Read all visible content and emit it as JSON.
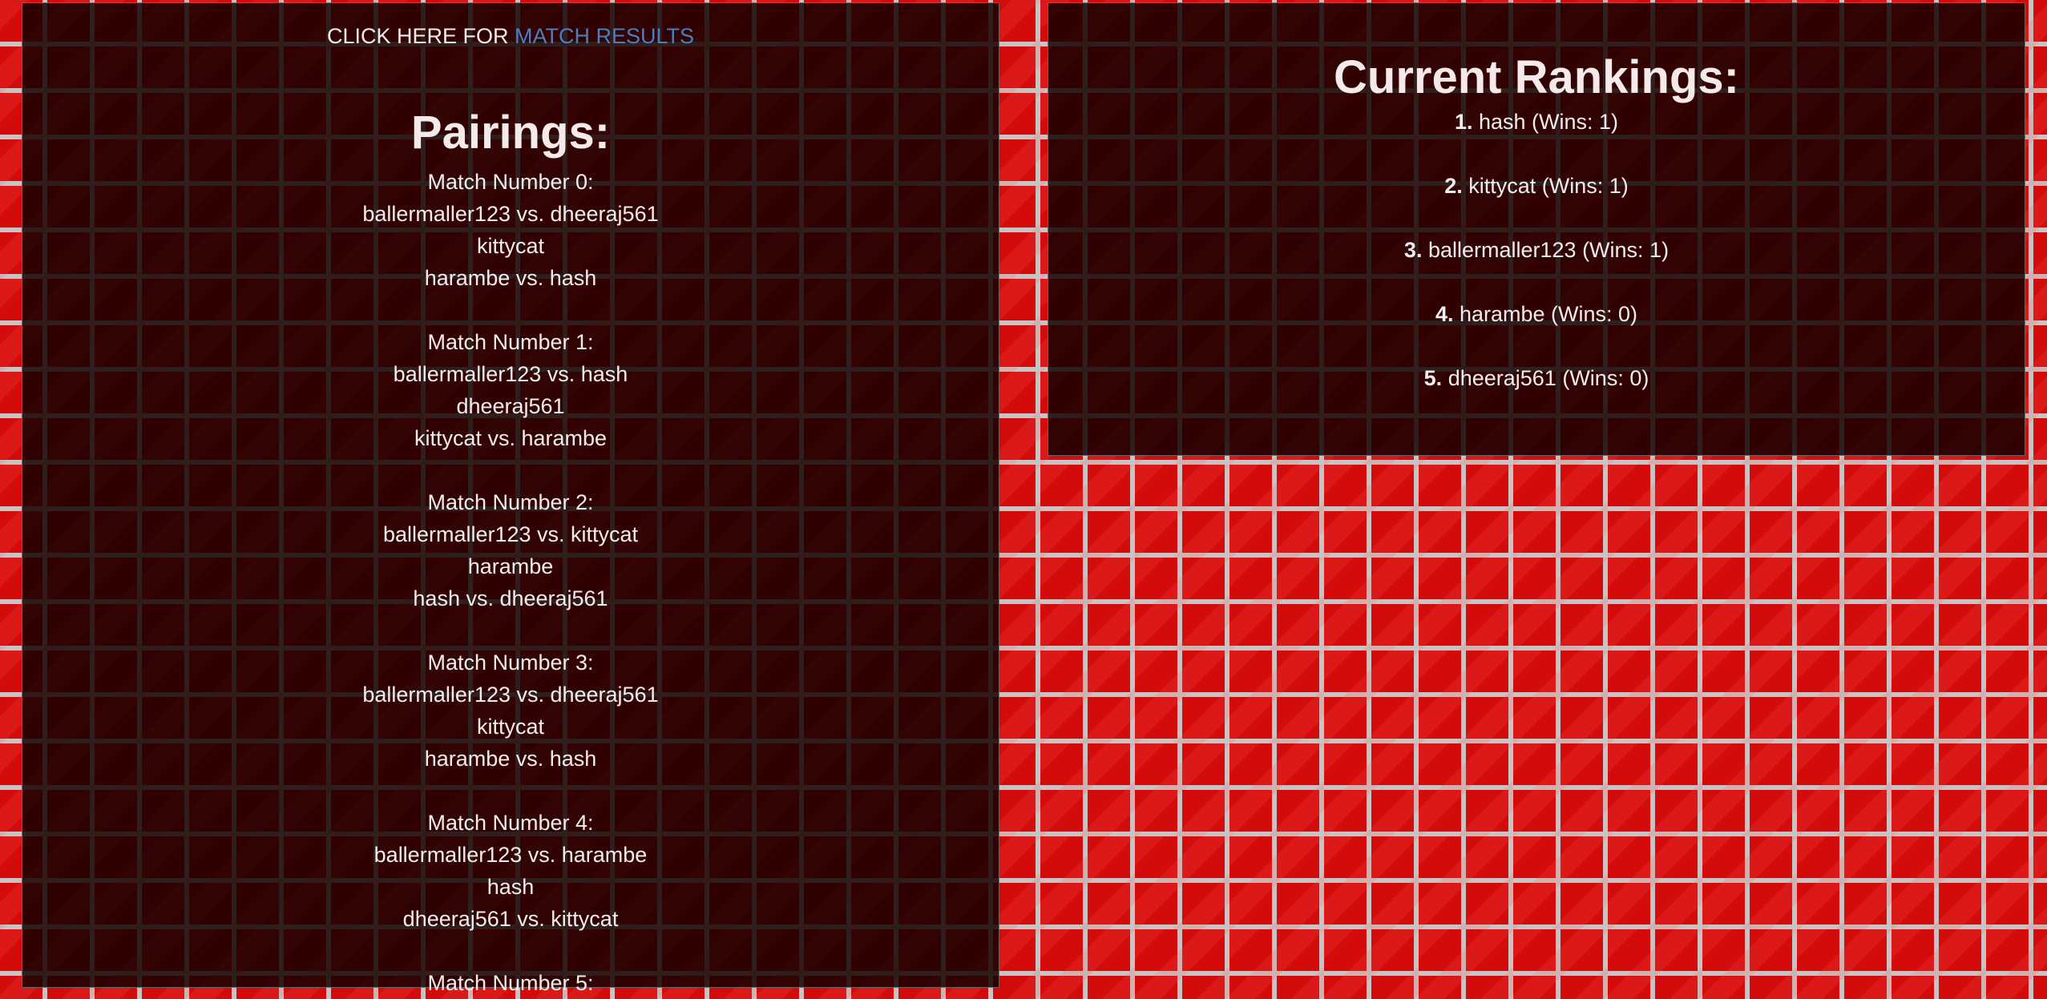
{
  "results_link": {
    "prefix": "CLICK HERE FOR",
    "link_text": "MATCH RESULTS"
  },
  "pairings": {
    "title": "Pairings:",
    "matches": [
      {
        "header": "Match Number 0:",
        "lines": [
          "ballermaller123 vs. dheeraj561",
          "kittycat",
          "harambe vs. hash"
        ]
      },
      {
        "header": "Match Number 1:",
        "lines": [
          "ballermaller123 vs. hash",
          "dheeraj561",
          "kittycat vs. harambe"
        ]
      },
      {
        "header": "Match Number 2:",
        "lines": [
          "ballermaller123 vs. kittycat",
          "harambe",
          "hash vs. dheeraj561"
        ]
      },
      {
        "header": "Match Number 3:",
        "lines": [
          "ballermaller123 vs. dheeraj561",
          "kittycat",
          "harambe vs. hash"
        ]
      },
      {
        "header": "Match Number 4:",
        "lines": [
          "ballermaller123 vs. harambe",
          "hash",
          "dheeraj561 vs. kittycat"
        ]
      },
      {
        "header": "Match Number 5:",
        "lines": []
      }
    ]
  },
  "rankings": {
    "title": "Current Rankings:",
    "entries": [
      {
        "rank": "1.",
        "text": "hash (Wins: 1)"
      },
      {
        "rank": "2.",
        "text": "kittycat (Wins: 1)"
      },
      {
        "rank": "3.",
        "text": "ballermaller123 (Wins: 1)"
      },
      {
        "rank": "4.",
        "text": "harambe (Wins: 0)"
      },
      {
        "rank": "5.",
        "text": "dheeraj561 (Wins: 0)"
      }
    ]
  },
  "colors": {
    "link": "#4a7ec0",
    "brick": "#d40b0b",
    "mortar": "#c9c3c3",
    "panel": "#120000"
  }
}
